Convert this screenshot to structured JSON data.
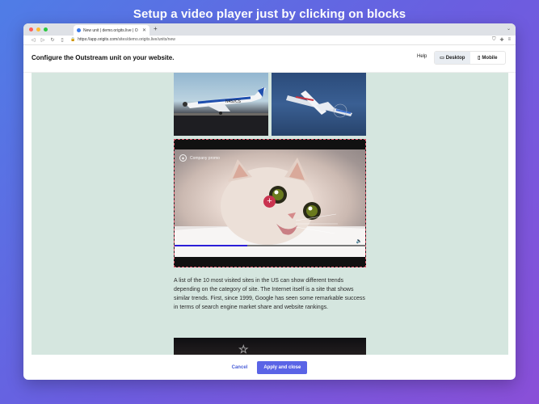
{
  "headline": "Setup a video player just by clicking on blocks",
  "browser": {
    "tab_title": "New unit | demo.origits.live | O",
    "tab_close": "✕",
    "new_tab": "+",
    "url_host": "https://app.origits.com",
    "url_path": "/sites/demo.origits.live/units/new",
    "colors": {
      "close": "#ff5f57",
      "minimize": "#febc2e",
      "zoom": "#28c840"
    }
  },
  "app": {
    "title": "Configure the Outstream unit on your website.",
    "help_label": "Help",
    "devices": [
      {
        "label": "Desktop",
        "icon": "monitor-icon",
        "active": true
      },
      {
        "label": "Mobile",
        "icon": "phone-icon",
        "active": false
      }
    ]
  },
  "video": {
    "promo_label": "Company promo",
    "progress": 0.38
  },
  "article": {
    "text": "A list of the 10 most visited sites in the US can show different trends depending on the category of site. The Internet itself is a site that shows similar trends. First, since 1999, Google has seen some remarkable success in terms of search engine market share and website rankings."
  },
  "footer": {
    "cancel_label": "Cancel",
    "apply_label": "Apply and close"
  },
  "accent": "#5a64e6"
}
